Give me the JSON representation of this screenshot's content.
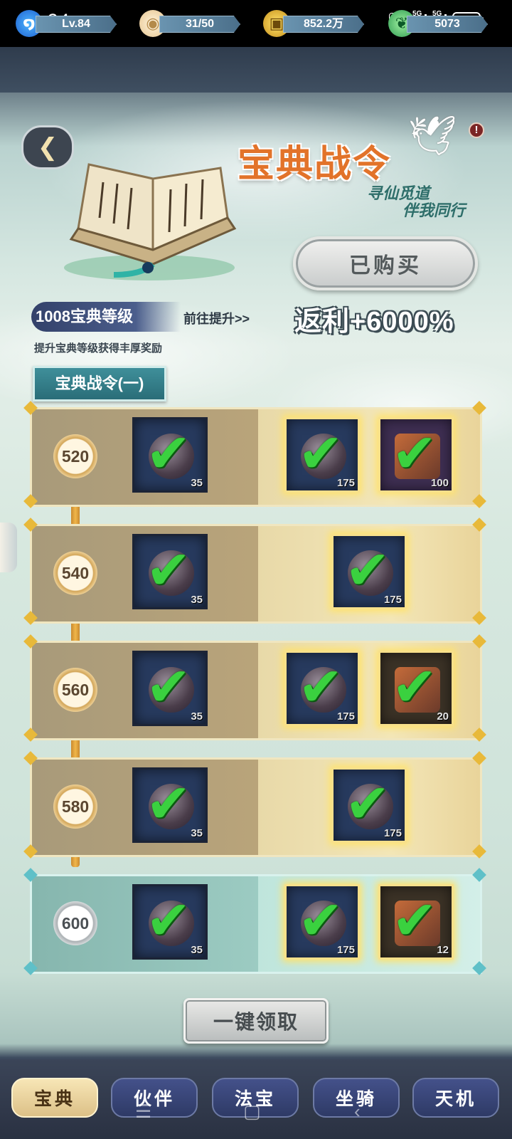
{
  "status_bar": {
    "time": "9:24",
    "hd_label": "HD",
    "signal1_label": "5G",
    "signal2_label": "5G",
    "battery": "65"
  },
  "resources": [
    {
      "icon": "level-swirl-icon",
      "value": "Lv.84"
    },
    {
      "icon": "bun-stamina-icon",
      "value": "31/50"
    },
    {
      "icon": "coin-icon",
      "value": "852.2万"
    },
    {
      "icon": "leaf-jade-icon",
      "value": "5073"
    }
  ],
  "header": {
    "title": "宝典战令",
    "subtitle_line1": "寻仙觅道",
    "subtitle_line2": "伴我同行",
    "bought_button": "已购买",
    "rebate": "返利+6000%",
    "level_text": "1008宝典等级",
    "goto_link": "前往提升>>",
    "level_desc": "提升宝典等级获得丰厚奖励",
    "tab_label": "宝典战令(一)"
  },
  "reward_rows": [
    {
      "level": "520",
      "free": {
        "count": "35"
      },
      "paid": [
        {
          "count": "175",
          "kind": "orb"
        },
        {
          "count": "100",
          "kind": "chest"
        }
      ]
    },
    {
      "level": "540",
      "free": {
        "count": "35"
      },
      "paid": [
        {
          "count": "175",
          "kind": "orb"
        }
      ]
    },
    {
      "level": "560",
      "free": {
        "count": "35"
      },
      "paid": [
        {
          "count": "175",
          "kind": "orb"
        },
        {
          "count": "20",
          "kind": "scroll"
        }
      ]
    },
    {
      "level": "580",
      "free": {
        "count": "35"
      },
      "paid": [
        {
          "count": "175",
          "kind": "orb"
        }
      ]
    },
    {
      "level": "600",
      "free": {
        "count": "35"
      },
      "paid": [
        {
          "count": "175",
          "kind": "orb"
        },
        {
          "count": "12",
          "kind": "paper"
        }
      ]
    }
  ],
  "claim_all_button": "一键领取",
  "bottom_nav": [
    {
      "label": "宝典",
      "active": true
    },
    {
      "label": "伙伴",
      "active": false
    },
    {
      "label": "法宝",
      "active": false
    },
    {
      "label": "坐骑",
      "active": false
    },
    {
      "label": "天机",
      "active": false
    }
  ],
  "colors": {
    "accent_title": "#e2732a",
    "claimed_check": "#3ad13f",
    "track_gold": "#f0b64a",
    "active_tab": "#f7e6b6"
  }
}
